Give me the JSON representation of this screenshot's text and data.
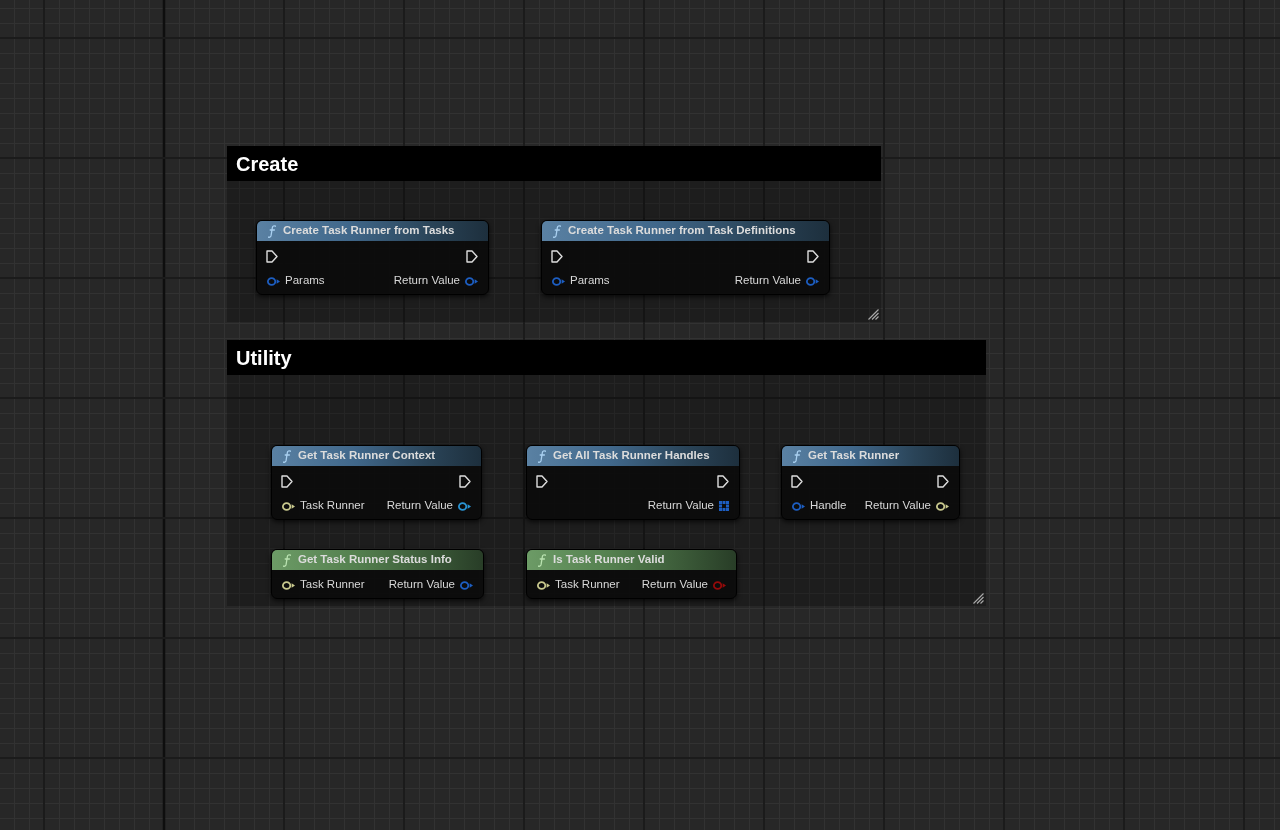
{
  "comments": [
    {
      "title": "Create",
      "nodes": [
        {
          "title": "Create Task Runner from Tasks",
          "kind": "function",
          "inputs": [
            {
              "label": "Params",
              "kind": "value",
              "color": "#1d5ec2"
            }
          ],
          "outputs": [
            {
              "label": "Return Value",
              "kind": "value",
              "color": "#1d5ec2"
            }
          ]
        },
        {
          "title": "Create Task Runner from Task Definitions",
          "kind": "function",
          "inputs": [
            {
              "label": "Params",
              "kind": "value",
              "color": "#1d5ec2"
            }
          ],
          "outputs": [
            {
              "label": "Return Value",
              "kind": "value",
              "color": "#1d5ec2"
            }
          ]
        }
      ]
    },
    {
      "title": "Utility",
      "nodes": [
        {
          "title": "Get Task Runner Context",
          "kind": "function",
          "inputs": [
            {
              "label": "Task Runner",
              "kind": "value",
              "color": "#c9c98e"
            }
          ],
          "outputs": [
            {
              "label": "Return Value",
              "kind": "value",
              "color": "#2a95d5"
            }
          ]
        },
        {
          "title": "Get All Task Runner Handles",
          "kind": "function",
          "outputs": [
            {
              "label": "Return Value",
              "kind": "array",
              "color": "#1d5ec2"
            }
          ]
        },
        {
          "title": "Get Task Runner",
          "kind": "function",
          "inputs": [
            {
              "label": "Handle",
              "kind": "value",
              "color": "#1d5ec2"
            }
          ],
          "outputs": [
            {
              "label": "Return Value",
              "kind": "value",
              "color": "#c9c98e"
            }
          ]
        },
        {
          "title": "Get Task Runner Status Info",
          "kind": "pure",
          "inputs": [
            {
              "label": "Task Runner",
              "kind": "value",
              "color": "#c9c98e"
            }
          ],
          "outputs": [
            {
              "label": "Return Value",
              "kind": "value",
              "color": "#1d5ec2"
            }
          ]
        },
        {
          "title": "Is Task Runner Valid",
          "kind": "pure",
          "inputs": [
            {
              "label": "Task Runner",
              "kind": "value",
              "color": "#c9c98e"
            }
          ],
          "outputs": [
            {
              "label": "Return Value",
              "kind": "value",
              "color": "#950a0a"
            }
          ]
        }
      ]
    }
  ]
}
